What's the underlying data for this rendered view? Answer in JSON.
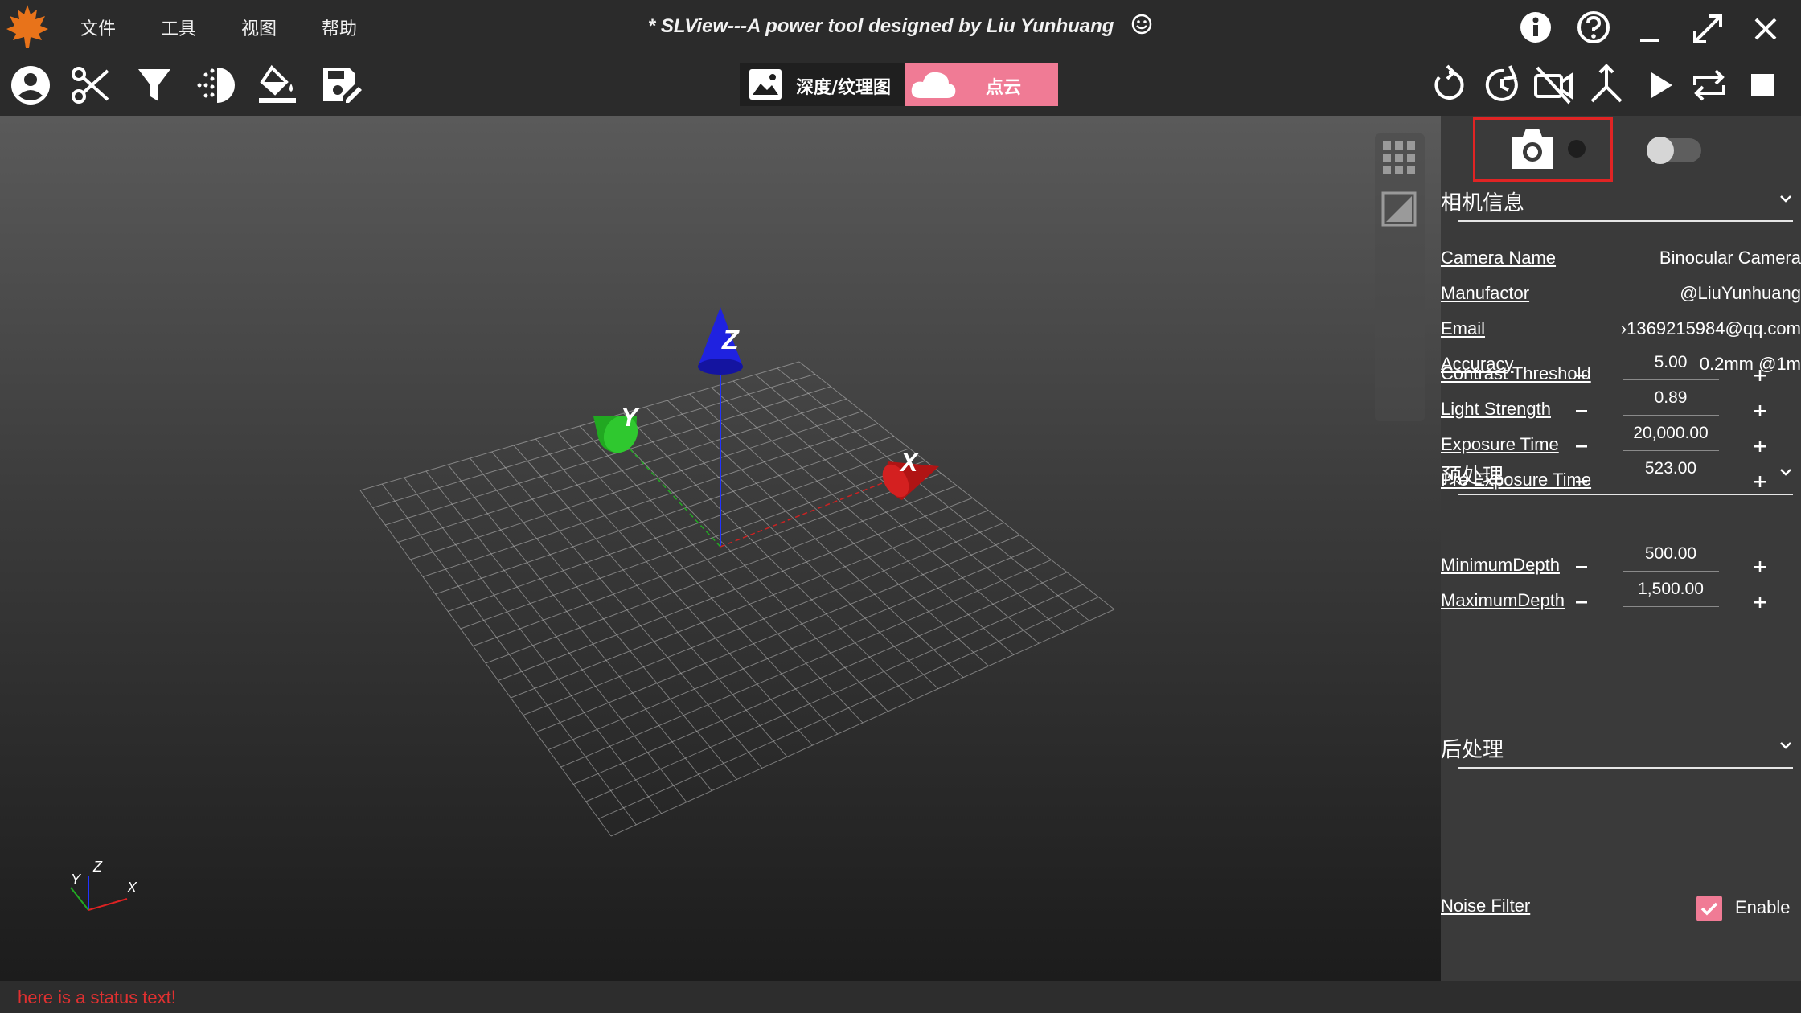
{
  "menu": [
    "文件",
    "工具",
    "视图",
    "帮助"
  ],
  "window": {
    "title": "* SLView---A power tool designed by Liu Yunhuang"
  },
  "mode_switch": {
    "depth_label": "深度/纹理图",
    "cloud_label": "点云",
    "active": "cloud",
    "active_color": "#f07b95"
  },
  "viewport": {
    "axis_labels": {
      "x": "X",
      "y": "Y",
      "z": "Z"
    },
    "gizmo_labels": {
      "x": "X",
      "y": "Y",
      "z": "Z"
    }
  },
  "panel": {
    "capture_toggle": {
      "on": false
    },
    "camera_info": {
      "title": "相机信息",
      "rows": [
        {
          "label": "Camera Name",
          "value": "Binocular Camera"
        },
        {
          "label": "Manufactor",
          "value": "@LiuYunhuang"
        },
        {
          "label": "Email",
          "value": "›1369215984@qq.com"
        },
        {
          "label": "Accuracy",
          "value": "0.2mm @1m"
        }
      ]
    },
    "preprocess": {
      "title": "预处理",
      "rows": [
        {
          "label": "Contrast Threshold",
          "value": "5.00"
        },
        {
          "label": "Light Strength",
          "value": "0.89"
        },
        {
          "label": "Exposure Time",
          "value": "20,000.00"
        },
        {
          "label": "Pre Exposure Time",
          "value": "523.00"
        }
      ]
    },
    "postprocess": {
      "title": "后处理",
      "rows": [
        {
          "label": "MinimumDepth",
          "value": "500.00"
        },
        {
          "label": "MaximumDepth",
          "value": "1,500.00"
        }
      ],
      "noise_filter": {
        "label": "Noise Filter",
        "checkbox_label": "Enable",
        "checked": true
      }
    }
  },
  "status": {
    "text": "here is a status text!",
    "color": "#e03030"
  }
}
